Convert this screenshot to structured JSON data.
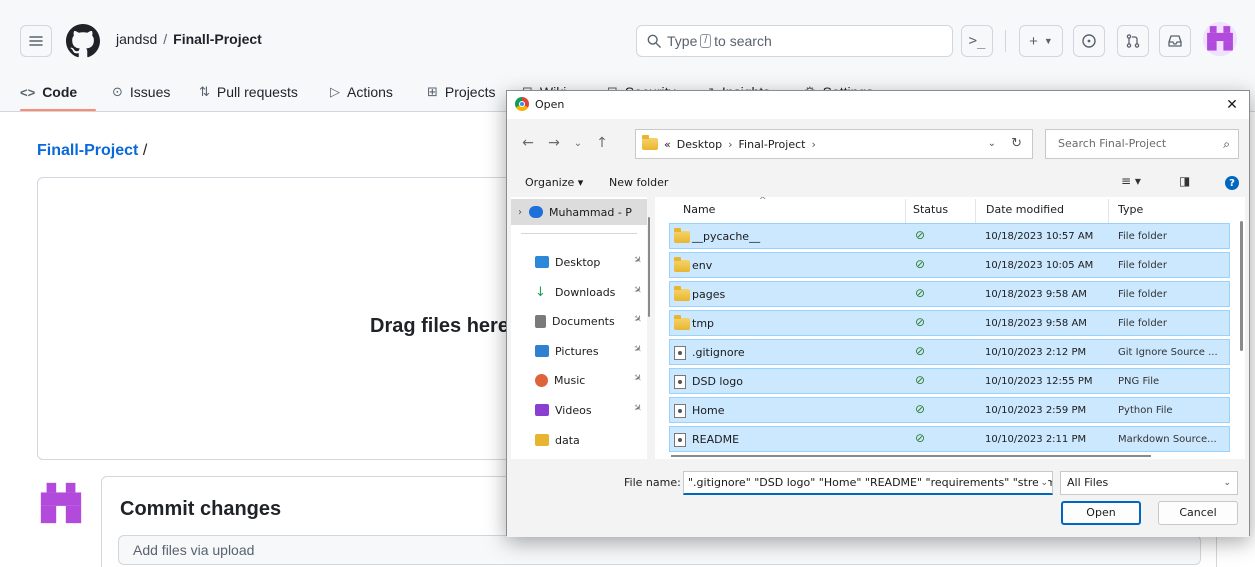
{
  "github": {
    "owner": "jandsd",
    "separator": "/",
    "repo": "Finall-Project",
    "search_prefix": "Type",
    "search_key": "/",
    "search_suffix": "to search",
    "command_glyph": ">_",
    "tabs": [
      {
        "label": "Code",
        "icon": "<>"
      },
      {
        "label": "Issues",
        "icon": "⊙"
      },
      {
        "label": "Pull requests",
        "icon": "⇅"
      },
      {
        "label": "Actions",
        "icon": "▷"
      },
      {
        "label": "Projects",
        "icon": "⊞"
      },
      {
        "label": "Wiki",
        "icon": "⊟"
      },
      {
        "label": "Security",
        "icon": "⊡"
      },
      {
        "label": "Insights",
        "icon": "↗"
      },
      {
        "label": "Settings",
        "icon": "⚙"
      }
    ],
    "breadcrumb_repo": "Finall-Project",
    "breadcrumb_sep": "/",
    "drop_text": "Drag files here",
    "commit_title": "Commit changes",
    "commit_placeholder": "Add files via upload",
    "accent_link": "#0969da",
    "accent_tab": "#fd8c73"
  },
  "dialog": {
    "title": "Open",
    "close_glyph": "✕",
    "address": {
      "prefix": "«",
      "crumbs": [
        "Desktop",
        "Final-Project"
      ]
    },
    "search_placeholder": "Search Final-Project",
    "toolbar": {
      "organize": "Organize ▾",
      "new_folder": "New folder",
      "help": "?"
    },
    "nav_items": [
      {
        "label": "Muhammad - P",
        "icon": "cloud-icon",
        "color": "#1e6fd9"
      },
      {
        "label": "Desktop",
        "icon": "desktop-icon",
        "color": "#2b88d8"
      },
      {
        "label": "Downloads",
        "icon": "download-icon",
        "color": "#1e9e5a"
      },
      {
        "label": "Documents",
        "icon": "documents-icon",
        "color": "#7a7a7a"
      },
      {
        "label": "Pictures",
        "icon": "pictures-icon",
        "color": "#2f80d1"
      },
      {
        "label": "Music",
        "icon": "music-icon",
        "color": "#e0643a"
      },
      {
        "label": "Videos",
        "icon": "videos-icon",
        "color": "#8a3fd1"
      },
      {
        "label": "data",
        "icon": "folder-icon",
        "color": "#e8b530"
      }
    ],
    "columns": {
      "name": "Name",
      "status": "Status",
      "date": "Date modified",
      "type": "Type"
    },
    "files": [
      {
        "name": "__pycache__",
        "status": "⊘",
        "date": "10/18/2023 10:57 AM",
        "type": "File folder",
        "kind": "folder"
      },
      {
        "name": "env",
        "status": "⊘",
        "date": "10/18/2023 10:05 AM",
        "type": "File folder",
        "kind": "folder"
      },
      {
        "name": "pages",
        "status": "⊘",
        "date": "10/18/2023 9:58 AM",
        "type": "File folder",
        "kind": "folder"
      },
      {
        "name": "tmp",
        "status": "⊘",
        "date": "10/18/2023 9:58 AM",
        "type": "File folder",
        "kind": "folder"
      },
      {
        "name": ".gitignore",
        "status": "⊘",
        "date": "10/10/2023 2:12 PM",
        "type": "Git Ignore Source ...",
        "kind": "file"
      },
      {
        "name": "DSD logo",
        "status": "⊘",
        "date": "10/10/2023 12:55 PM",
        "type": "PNG File",
        "kind": "file"
      },
      {
        "name": "Home",
        "status": "⊘",
        "date": "10/10/2023 2:59 PM",
        "type": "Python File",
        "kind": "file"
      },
      {
        "name": "README",
        "status": "⊘",
        "date": "10/10/2023 2:11 PM",
        "type": "Markdown Source...",
        "kind": "file"
      }
    ],
    "file_name_label": "File name:",
    "file_name_value": "\".gitignore\" \"DSD logo\" \"Home\" \"README\" \"requirements\" \"streaming",
    "file_type": "All Files",
    "open_label": "Open",
    "cancel_label": "Cancel"
  }
}
